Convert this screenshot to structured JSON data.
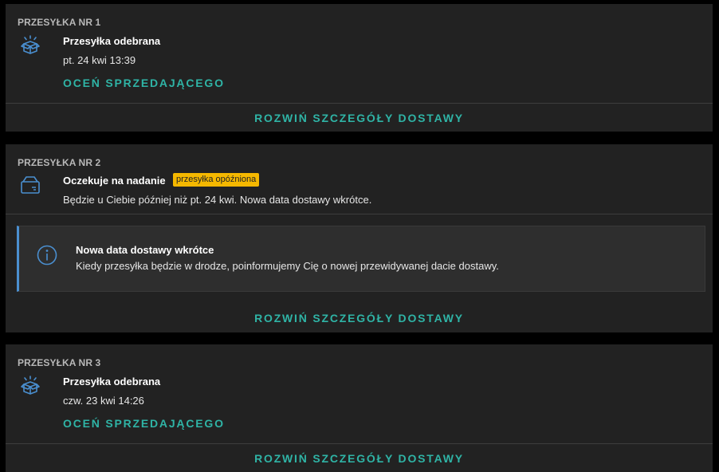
{
  "shipments": [
    {
      "label": "PRZESYŁKA NR 1",
      "icon": "open-box-icon",
      "status": "Przesyłka odebrana",
      "date": "pt. 24 kwi 13:39",
      "rate_label": "OCEŃ SPRZEDAJĄCEGO",
      "expand_label": "ROZWIŃ SZCZEGÓŁY DOSTAWY"
    },
    {
      "label": "PRZESYŁKA NR 2",
      "icon": "box-icon",
      "status": "Oczekuje na nadanie",
      "badge": "przesyłka opóźniona",
      "date": "Będzie u Ciebie później niż pt. 24 kwi. Nowa data dostawy wkrótce.",
      "info": {
        "icon": "info-icon",
        "title": "Nowa data dostawy wkrótce",
        "text": "Kiedy przesyłka będzie w drodze, poinformujemy Cię o nowej przewidywanej dacie dostawy."
      },
      "expand_label": "ROZWIŃ SZCZEGÓŁY DOSTAWY"
    },
    {
      "label": "PRZESYŁKA NR 3",
      "icon": "open-box-icon",
      "status": "Przesyłka odebrana",
      "date": "czw. 23 kwi 14:26",
      "rate_label": "OCEŃ SPRZEDAJĄCEGO",
      "expand_label": "ROZWIŃ SZCZEGÓŁY DOSTAWY"
    }
  ],
  "colors": {
    "accent": "#2fb4a6",
    "icon": "#4a8fd0",
    "badge": "#f5b800",
    "card": "#222222",
    "background": "#000000"
  }
}
